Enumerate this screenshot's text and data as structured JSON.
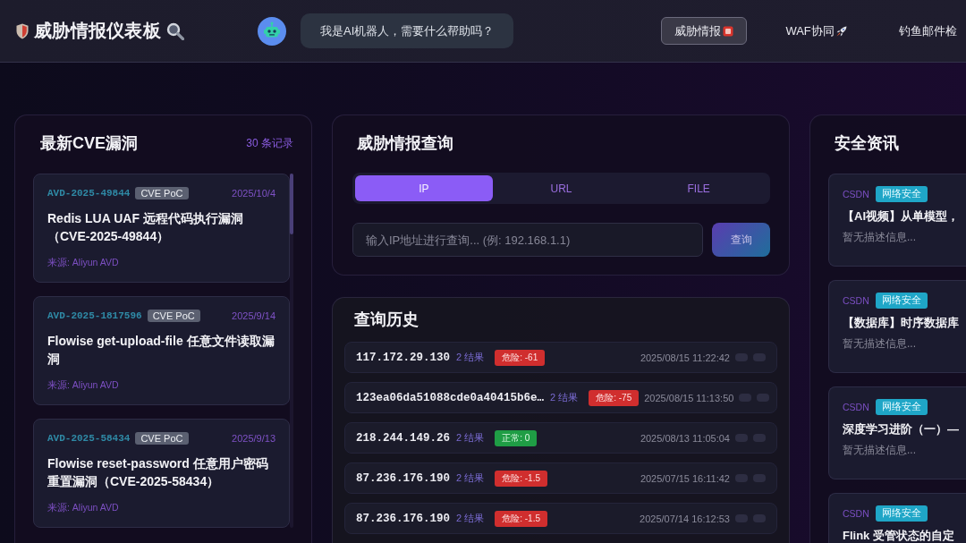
{
  "header": {
    "title": "威胁情报仪表板",
    "assistant": {
      "message": "我是AI机器人，需要什么帮助吗？"
    },
    "nav": [
      {
        "label": "威胁情报",
        "selected": true
      },
      {
        "label": "WAF协同",
        "selected": false
      },
      {
        "label": "钓鱼邮件检",
        "selected": false
      }
    ]
  },
  "cve_panel": {
    "title": "最新CVE漏洞",
    "count": "30 条记录",
    "items": [
      {
        "id": "AVD-2025-49844",
        "tag": "CVE PoC",
        "date": "2025/10/4",
        "title": "Redis LUA UAF 远程代码执行漏洞（CVE-2025-49844）",
        "source": "来源: Aliyun AVD"
      },
      {
        "id": "AVD-2025-1817596",
        "tag": "CVE PoC",
        "date": "2025/9/14",
        "title": "Flowise get-upload-file 任意文件读取漏洞",
        "source": "来源: Aliyun AVD"
      },
      {
        "id": "AVD-2025-58434",
        "tag": "CVE PoC",
        "date": "2025/9/13",
        "title": "Flowise reset-password 任意用户密码重置漏洞（CVE-2025-58434）",
        "source": "来源: Aliyun AVD"
      }
    ]
  },
  "query_panel": {
    "title": "威胁情报查询",
    "tabs": [
      {
        "label": "IP",
        "selected": true
      },
      {
        "label": "URL",
        "selected": false
      },
      {
        "label": "FILE",
        "selected": false
      }
    ],
    "search": {
      "placeholder": "输入IP地址进行查询... (例: 192.168.1.1)"
    },
    "button": "查询"
  },
  "history": {
    "title": "查询历史",
    "rows": [
      {
        "query": "117.172.29.130",
        "results": "2 结果",
        "verdict": {
          "kind": "danger",
          "label": "危险: -61"
        },
        "time": "2025/08/15 11:22:42"
      },
      {
        "query": "123ea06da51088cde0a40415b6e…",
        "results": "2 结果",
        "verdict": {
          "kind": "danger",
          "label": "危险: -75"
        },
        "time": "2025/08/15 11:13:50"
      },
      {
        "query": "218.244.149.26",
        "results": "2 结果",
        "verdict": {
          "kind": "normal",
          "label": "正常: 0"
        },
        "time": "2025/08/13 11:05:04"
      },
      {
        "query": "87.236.176.190",
        "results": "2 结果",
        "verdict": {
          "kind": "danger",
          "label": "危险: -1.5"
        },
        "time": "2025/07/15 16:11:42"
      },
      {
        "query": "87.236.176.190",
        "results": "2 结果",
        "verdict": {
          "kind": "danger",
          "label": "危险: -1.5"
        },
        "time": "2025/07/14 16:12:53"
      }
    ]
  },
  "news_panel": {
    "title": "安全资讯",
    "items": [
      {
        "source": "CSDN",
        "tag": "网络安全",
        "title": "【AI视频】从单模型，",
        "description": "暂无描述信息..."
      },
      {
        "source": "CSDN",
        "tag": "网络安全",
        "title": "【数据库】时序数据库",
        "description": "暂无描述信息..."
      },
      {
        "source": "CSDN",
        "tag": "网络安全",
        "title": "深度学习进阶（一）—",
        "description": "暂无描述信息..."
      },
      {
        "source": "CSDN",
        "tag": "网络安全",
        "title": "Flink 受管状态的自定"
      }
    ]
  }
}
